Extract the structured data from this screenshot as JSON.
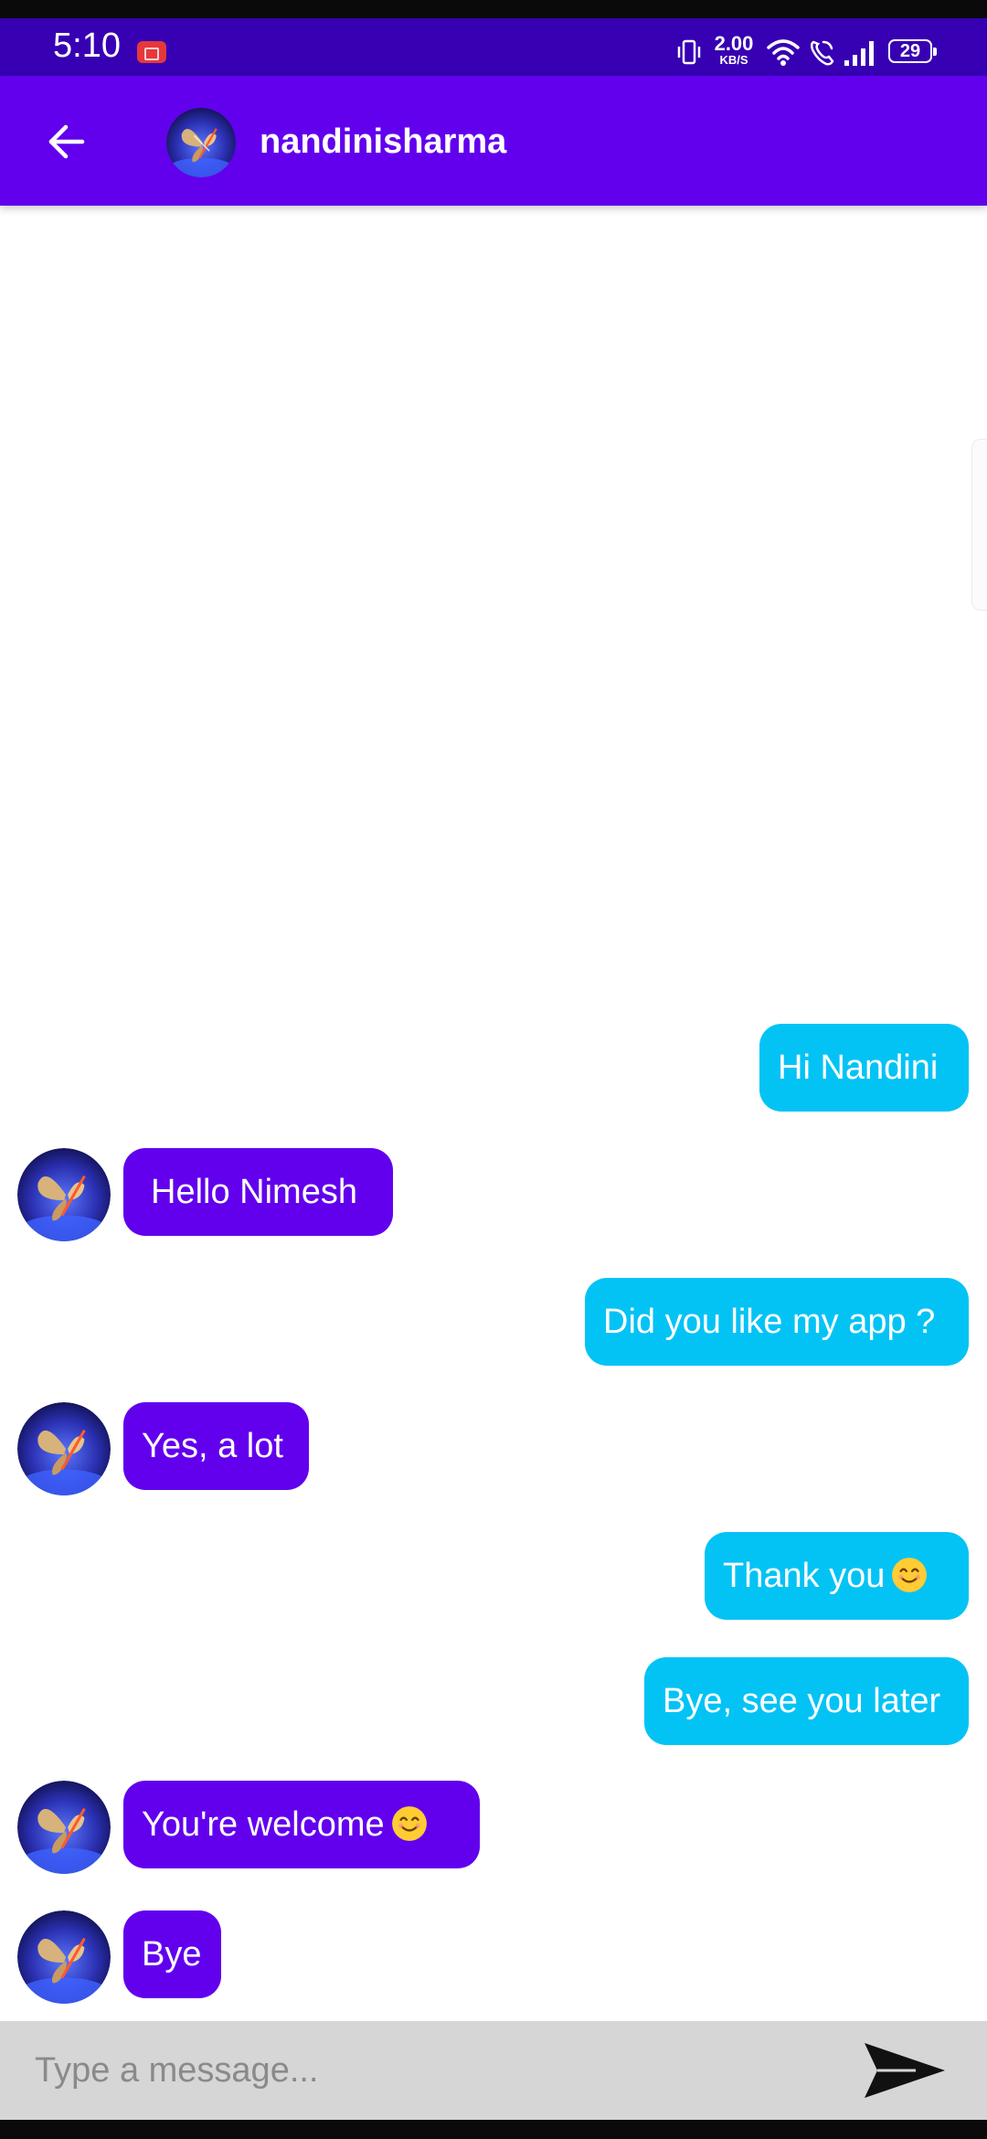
{
  "status_bar": {
    "time": "5:10",
    "net_speed_value": "2.00",
    "net_speed_unit": "KB/S",
    "battery": "29",
    "icons": [
      "screen-record-icon",
      "vibrate-icon",
      "wifi-icon",
      "wifi-call-icon",
      "signal-icon",
      "battery-icon"
    ]
  },
  "header": {
    "back_icon": "arrow-left-icon",
    "contact_name": "nandinisharma"
  },
  "messages": [
    {
      "side": "sent",
      "text": "Hi Nandini"
    },
    {
      "side": "received",
      "text": "Hello Nimesh"
    },
    {
      "side": "sent",
      "text": "Did you like my app ?"
    },
    {
      "side": "received",
      "text": "Yes, a lot"
    },
    {
      "side": "sent",
      "text": "Thank you",
      "emoji": "smiling-face-icon"
    },
    {
      "side": "sent",
      "text": "Bye, see you later"
    },
    {
      "side": "received",
      "text": "You're welcome",
      "emoji": "smiling-face-icon"
    },
    {
      "side": "received",
      "text": "Bye"
    }
  ],
  "composer": {
    "placeholder": "Type a message...",
    "value": "",
    "send_icon": "send-icon"
  },
  "colors": {
    "status_bar": "#3700b3",
    "app_bar": "#6200ee",
    "sent_bubble": "#03c3f5",
    "received_bubble": "#6200ee",
    "input_bar": "#d6d6d6"
  }
}
